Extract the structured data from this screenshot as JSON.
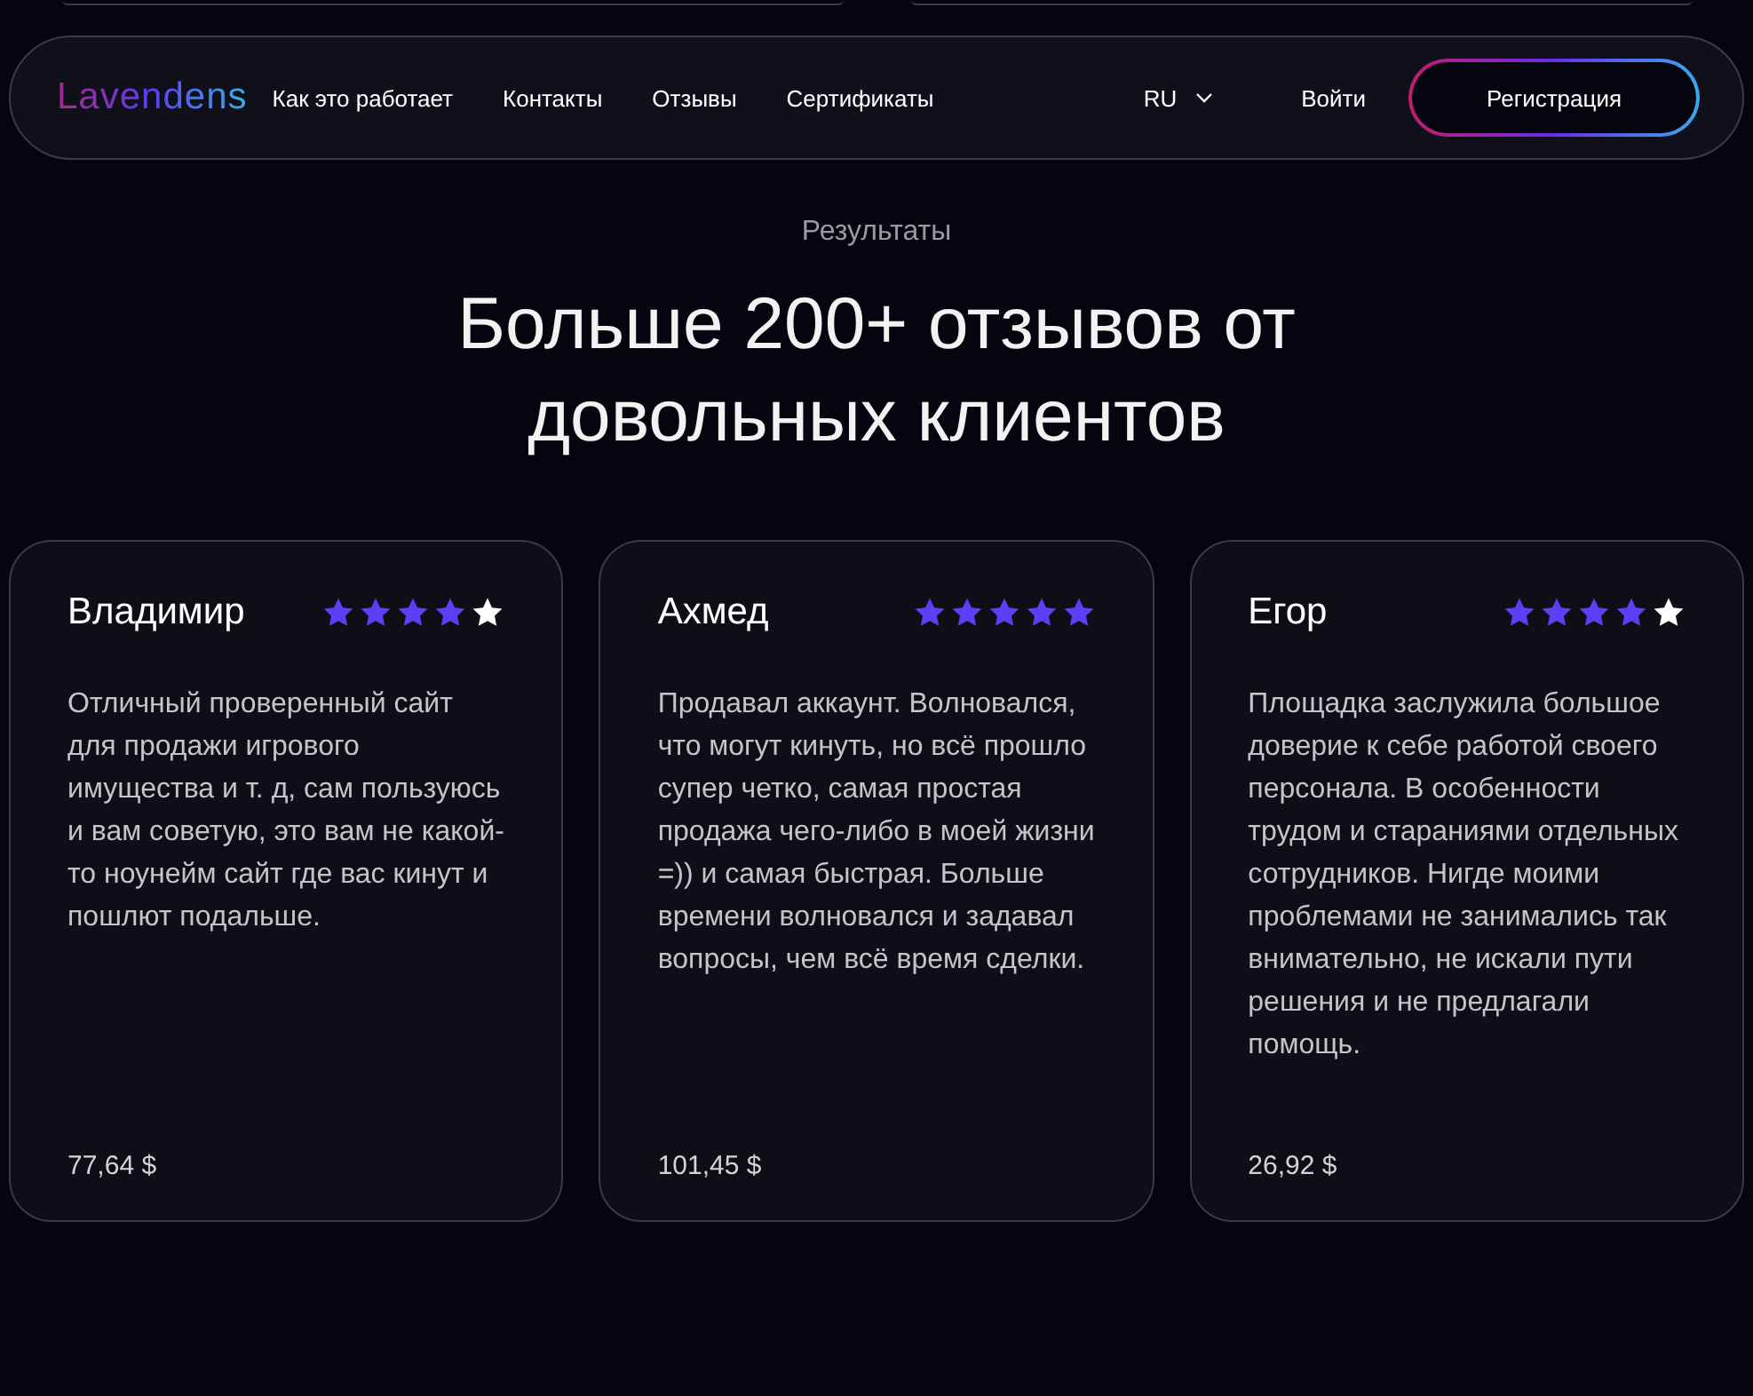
{
  "nav": {
    "logo": "Lavendens",
    "links": [
      "Как это работает",
      "Контакты",
      "Отзывы",
      "Сертификаты"
    ],
    "language": "RU",
    "login": "Войти",
    "register": "Регистрация"
  },
  "section": {
    "eyebrow": "Результаты",
    "title": "Больше 200+ отзывов от довольных клиентов"
  },
  "reviews": [
    {
      "name": "Владимир",
      "stars": 4,
      "text": "Отличный проверенный сайт для продажи игрового имущества и т. д, сам пользуюсь и вам советую, это вам не какой-то ноунейм сайт где вас кинут и пошлют подальше.",
      "amount": "77,64 $"
    },
    {
      "name": "Ахмед",
      "stars": 5,
      "text": "Продавал аккаунт. Волновался, что могут кинуть, но всё прошло супер четко, самая простая продажа чего-либо в моей жизни =)) и самая быстрая. Больше времени волновался и задавал вопросы, чем всё время сделки.",
      "amount": "101,45 $"
    },
    {
      "name": "Егор",
      "stars": 4,
      "text": "Площадка заслужила большое доверие к себе работой своего персонала. В особенности трудом и стараниями отдельных сотрудников. Нигде моими проблемами не занимались так внимательно, не искали пути решения и не предлагали помощь.",
      "amount": "26,92 $"
    }
  ]
}
